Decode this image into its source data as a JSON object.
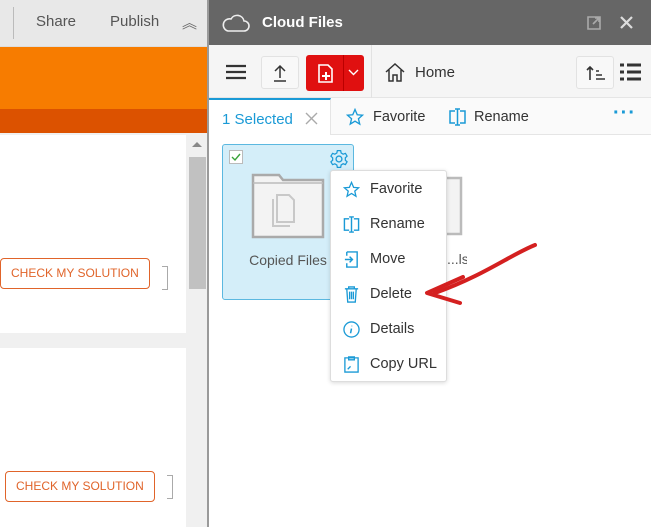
{
  "left": {
    "share": "Share",
    "publish": "Publish",
    "check_button": "CHECK MY SOLUTION"
  },
  "panel": {
    "title": "Cloud Files",
    "breadcrumb": "Home"
  },
  "selection": {
    "label": "1 Selected",
    "favorite": "Favorite",
    "rename": "Rename"
  },
  "files": [
    {
      "name": "Copied Files",
      "selected": true
    },
    {
      "name": "...ls",
      "selected": false
    }
  ],
  "menu": [
    {
      "label": "Favorite",
      "icon": "star-icon"
    },
    {
      "label": "Rename",
      "icon": "rename-icon"
    },
    {
      "label": "Move",
      "icon": "move-icon"
    },
    {
      "label": "Delete",
      "icon": "trash-icon"
    },
    {
      "label": "Details",
      "icon": "info-icon"
    },
    {
      "label": "Copy URL",
      "icon": "clipboard-icon"
    }
  ],
  "colors": {
    "accent": "#1a9ad6",
    "orange": "#f77c00",
    "red": "#e01010",
    "annotation": "#d42020"
  }
}
